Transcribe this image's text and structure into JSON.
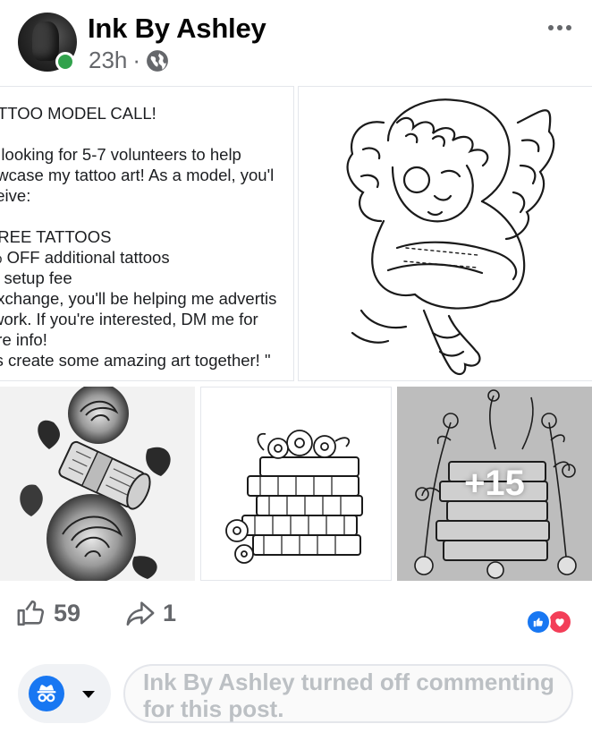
{
  "post": {
    "page_name": "Ink By Ashley",
    "time": "23h",
    "separator": "·",
    "audience_icon": "globe-icon",
    "more_icon": "more-dots-icon"
  },
  "text_tile": {
    "lines": "ATTOO MODEL CALL!\n\nn looking for 5-7 volunteers to help\nowcase my tattoo art! As a model, you'l\nceive:\n\nFREE TATTOOS\n% OFF additional tattoos\nw setup fee\nexchange, you'll be helping me advertis\n work. If you're interested, DM me for\nore info!\nt's create some amazing art together! \""
  },
  "images": {
    "cherub": "cherub-illustration",
    "roses": "rose-money-illustration",
    "books": "flower-books-illustration",
    "more_books": "books-wildflowers-illustration"
  },
  "more_overlay": {
    "count": "+15"
  },
  "actions": {
    "like_count": "59",
    "share_count": "1",
    "like_icon": "thumbs-up-icon",
    "share_icon": "share-arrow-icon"
  },
  "reactions": [
    "like-reaction-icon",
    "love-reaction-icon"
  ],
  "comment": {
    "disabled_text": "Ink By Ashley turned off commenting for this post.",
    "identity_icon": "anonymous-avatar-icon",
    "caret_icon": "chevron-down-icon"
  },
  "colors": {
    "facebook_blue": "#1877f2",
    "love_red": "#f33e58",
    "online_green": "#31a24c",
    "secondary_text": "#65676b"
  }
}
